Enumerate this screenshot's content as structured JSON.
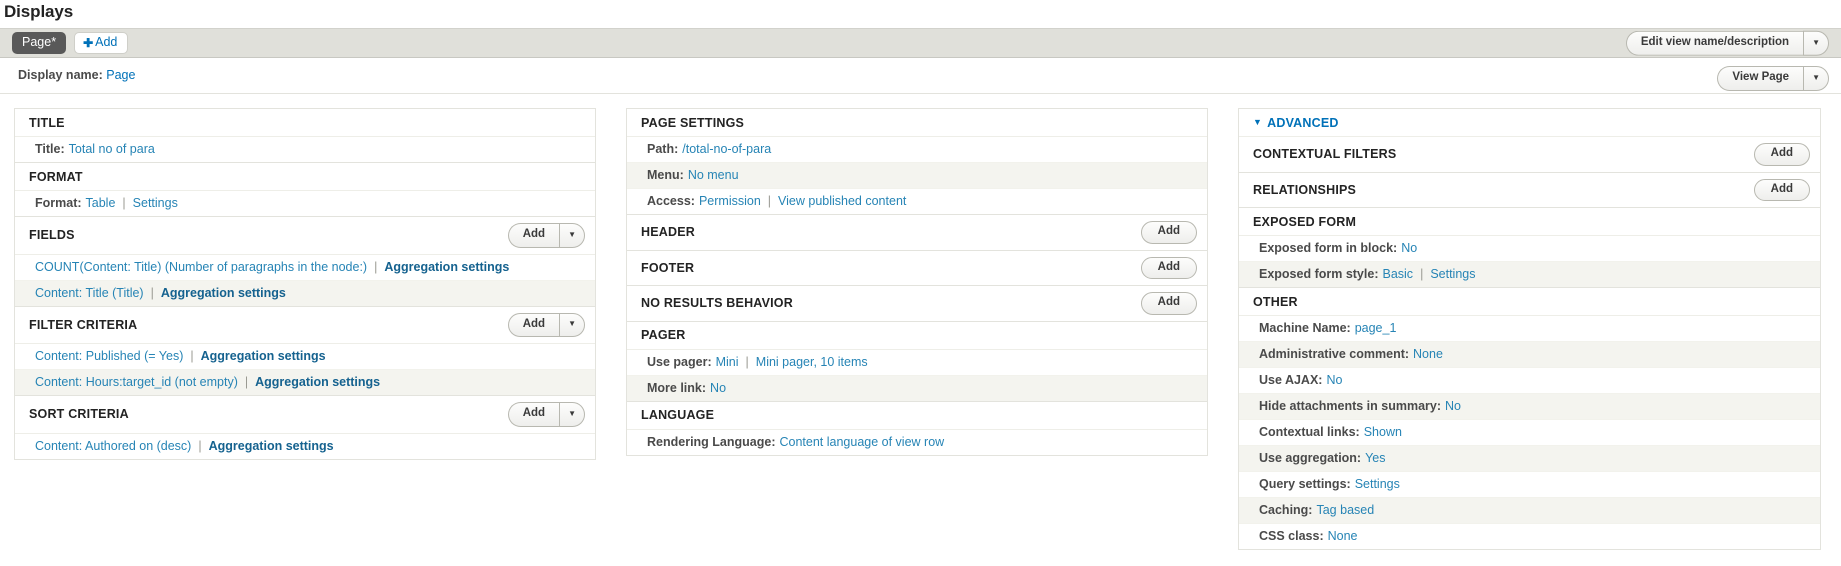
{
  "header": {
    "page_title": "Displays",
    "active_tab": "Page*",
    "add_display_label": "Add",
    "edit_view_button": "Edit view name/description",
    "dropdown_icon": "caret-down-icon"
  },
  "display": {
    "name_label": "Display name:",
    "name_value": "Page",
    "view_page_button": "View Page"
  },
  "labels": {
    "add": "Add",
    "aggregation_settings": "Aggregation settings",
    "separator": "|"
  },
  "left_column": {
    "sections": [
      {
        "title": "TITLE",
        "has_add": false,
        "rows": [
          {
            "label": "Title:",
            "links": [
              "Total no of para"
            ]
          }
        ]
      },
      {
        "title": "FORMAT",
        "has_add": false,
        "rows": [
          {
            "label": "Format:",
            "links": [
              "Table",
              "Settings"
            ]
          }
        ]
      },
      {
        "title": "FIELDS",
        "has_add": true,
        "has_add_dropdown": true,
        "rows": [
          {
            "label": "",
            "links": [
              "COUNT(Content: Title) (Number of paragraphs in the node:)",
              "Aggregation settings"
            ]
          },
          {
            "label": "",
            "links": [
              "Content: Title (Title)",
              "Aggregation settings"
            ]
          }
        ]
      },
      {
        "title": "FILTER CRITERIA",
        "has_add": true,
        "has_add_dropdown": true,
        "rows": [
          {
            "label": "",
            "links": [
              "Content: Published (= Yes)",
              "Aggregation settings"
            ]
          },
          {
            "label": "",
            "links": [
              "Content: Hours:target_id (not empty)",
              "Aggregation settings"
            ]
          }
        ]
      },
      {
        "title": "SORT CRITERIA",
        "has_add": true,
        "has_add_dropdown": true,
        "rows": [
          {
            "label": "",
            "links": [
              "Content: Authored on (desc)",
              "Aggregation settings"
            ]
          }
        ]
      }
    ]
  },
  "middle_column": {
    "sections": [
      {
        "title": "PAGE SETTINGS",
        "has_add": false,
        "rows": [
          {
            "label": "Path:",
            "links": [
              "/total-no-of-para"
            ]
          },
          {
            "label": "Menu:",
            "links": [
              "No menu"
            ]
          },
          {
            "label": "Access:",
            "links": [
              "Permission",
              "View published content"
            ]
          }
        ]
      },
      {
        "title": "HEADER",
        "has_add": true,
        "has_add_dropdown": false,
        "rows": []
      },
      {
        "title": "FOOTER",
        "has_add": true,
        "has_add_dropdown": false,
        "rows": []
      },
      {
        "title": "NO RESULTS BEHAVIOR",
        "has_add": true,
        "has_add_dropdown": false,
        "rows": []
      },
      {
        "title": "PAGER",
        "has_add": false,
        "rows": [
          {
            "label": "Use pager:",
            "links": [
              "Mini",
              "Mini pager, 10 items"
            ]
          },
          {
            "label": "More link:",
            "links": [
              "No"
            ]
          }
        ]
      },
      {
        "title": "LANGUAGE",
        "has_add": false,
        "rows": [
          {
            "label": "Rendering Language:",
            "links": [
              "Content language of view row"
            ]
          }
        ]
      }
    ]
  },
  "right_column": {
    "advanced_title": "ADVANCED",
    "advanced_expanded": true,
    "sections": [
      {
        "title": "CONTEXTUAL FILTERS",
        "has_add": true,
        "has_add_dropdown": false,
        "rows": []
      },
      {
        "title": "RELATIONSHIPS",
        "has_add": true,
        "has_add_dropdown": false,
        "rows": []
      },
      {
        "title": "EXPOSED FORM",
        "has_add": false,
        "rows": [
          {
            "label": "Exposed form in block:",
            "links": [
              "No"
            ]
          },
          {
            "label": "Exposed form style:",
            "links": [
              "Basic",
              "Settings"
            ]
          }
        ]
      },
      {
        "title": "OTHER",
        "has_add": false,
        "rows": [
          {
            "label": "Machine Name:",
            "links": [
              "page_1"
            ]
          },
          {
            "label": "Administrative comment:",
            "links": [
              "None"
            ]
          },
          {
            "label": "Use AJAX:",
            "links": [
              "No"
            ]
          },
          {
            "label": "Hide attachments in summary:",
            "links": [
              "No"
            ]
          },
          {
            "label": "Contextual links:",
            "links": [
              "Shown"
            ]
          },
          {
            "label": "Use aggregation:",
            "links": [
              "Yes"
            ]
          },
          {
            "label": "Query settings:",
            "links": [
              "Settings"
            ]
          },
          {
            "label": "Caching:",
            "links": [
              "Tag based"
            ]
          },
          {
            "label": "CSS class:",
            "links": [
              "None"
            ]
          }
        ]
      }
    ]
  },
  "colors": {
    "link": "#2684b5",
    "strong_link": "#15628f",
    "tab_active_bg": "#595959",
    "bar_bg": "#e0e0da",
    "zebra": "#f4f4ef"
  }
}
